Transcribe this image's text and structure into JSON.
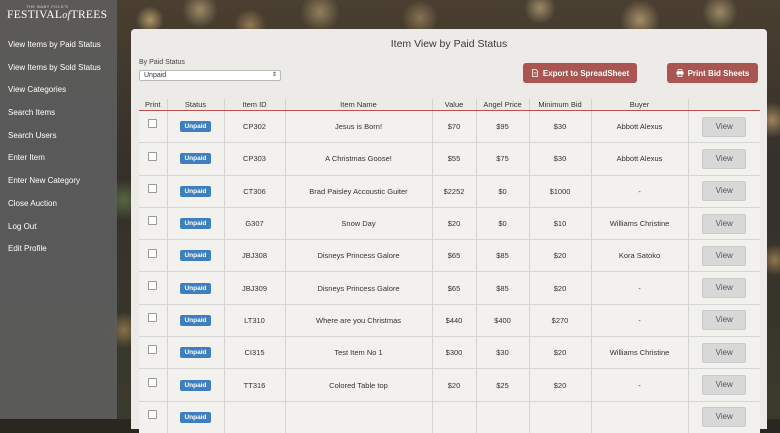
{
  "brand": {
    "tagline": "THE BABY FOLD'S",
    "name_part1": "FESTIVAL",
    "name_of": "of",
    "name_part2": "TREES"
  },
  "sidebar": {
    "items": [
      {
        "label": "View Items by Paid Status"
      },
      {
        "label": "View Items by Sold Status"
      },
      {
        "label": "View Categories"
      },
      {
        "label": "Search Items"
      },
      {
        "label": "Search Users"
      },
      {
        "label": "Enter Item"
      },
      {
        "label": "Enter New Category"
      },
      {
        "label": "Close Auction"
      },
      {
        "label": "Log Out"
      },
      {
        "label": "Edit Profile"
      }
    ]
  },
  "page": {
    "title": "Item View by Paid Status"
  },
  "filter": {
    "label": "By Paid Status",
    "selected": "Unpaid"
  },
  "actions": {
    "export_label": "Export to SpreadSheet",
    "print_label": "Print Bid Sheets"
  },
  "table": {
    "headers": [
      "Print",
      "Status",
      "Item ID",
      "Item Name",
      "Value",
      "Angel Price",
      "Minimum Bid",
      "Buyer",
      ""
    ],
    "view_label": "View",
    "rows": [
      {
        "status": "Unpaid",
        "id": "CP302",
        "name": "Jesus is Born!",
        "value": "$70",
        "angel": "$95",
        "min": "$30",
        "buyer": "Abbott Alexus"
      },
      {
        "status": "Unpaid",
        "id": "CP303",
        "name": "A Christmas Goose!",
        "value": "$55",
        "angel": "$75",
        "min": "$30",
        "buyer": "Abbott Alexus"
      },
      {
        "status": "Unpaid",
        "id": "CT306",
        "name": "Brad Paisley Accoustic Guiter",
        "value": "$2252",
        "angel": "$0",
        "min": "$1000",
        "buyer": "-"
      },
      {
        "status": "Unpaid",
        "id": "G307",
        "name": "Snow Day",
        "value": "$20",
        "angel": "$0",
        "min": "$10",
        "buyer": "Williams Christine"
      },
      {
        "status": "Unpaid",
        "id": "JBJ308",
        "name": "Disneys Princess Galore",
        "value": "$65",
        "angel": "$85",
        "min": "$20",
        "buyer": "Kora Satoko"
      },
      {
        "status": "Unpaid",
        "id": "JBJ309",
        "name": "Disneys Princess Galore",
        "value": "$65",
        "angel": "$85",
        "min": "$20",
        "buyer": "-"
      },
      {
        "status": "Unpaid",
        "id": "LT310",
        "name": "Where are you Christmas",
        "value": "$440",
        "angel": "$400",
        "min": "$270",
        "buyer": "-"
      },
      {
        "status": "Unpaid",
        "id": "CI315",
        "name": "Test Item No 1",
        "value": "$300",
        "angel": "$30",
        "min": "$20",
        "buyer": "Williams Christine"
      },
      {
        "status": "Unpaid",
        "id": "TT316",
        "name": "Colored Table top",
        "value": "$20",
        "angel": "$25",
        "min": "$20",
        "buyer": "-"
      },
      {
        "status": "Unpaid",
        "id": "",
        "name": "",
        "value": "",
        "angel": "",
        "min": "",
        "buyer": ""
      }
    ]
  }
}
